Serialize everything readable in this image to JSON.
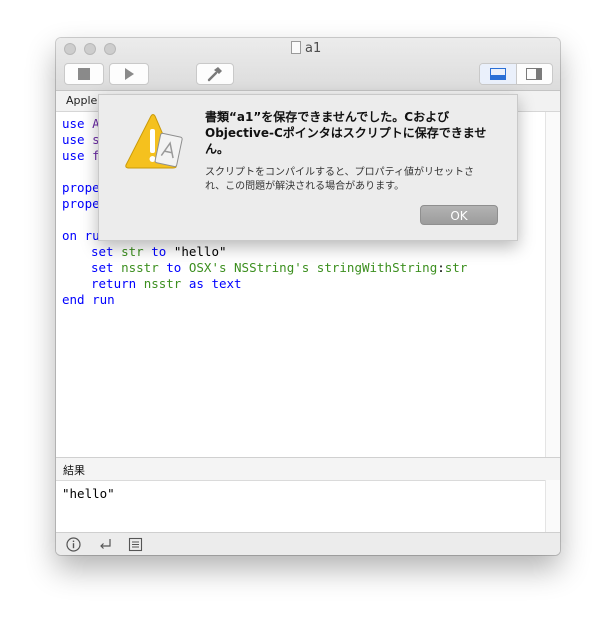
{
  "window": {
    "title": "a1"
  },
  "toolbar": {
    "stop": "stop-icon",
    "run": "play-icon",
    "compile": "hammer-icon",
    "view_bottom": "split-bottom-icon",
    "view_right": "split-right-icon"
  },
  "tabbar": {
    "label": "AppleS"
  },
  "editor": {
    "lines": [
      {
        "kw": "use",
        "rest": " A"
      },
      {
        "kw": "use",
        "rest": " s"
      },
      {
        "kw": "use",
        "rest": " f"
      },
      {
        "kw": "prope",
        "rest": ""
      },
      {
        "kw": "prope",
        "rest": ""
      },
      {
        "kw": "on",
        "rest": " ru"
      },
      {
        "kw": "set",
        "var": "str",
        "kw2": "to",
        "str": "\"hello\""
      },
      {
        "kw": "set",
        "var": "nsstr",
        "kw2": "to",
        "rest": "OSX's NSString's stringWithString",
        "colon": ":",
        "arg": "str"
      },
      {
        "kw": "return",
        "var": "nsstr",
        "kw2": "as",
        "rest": "text"
      },
      {
        "kw": "end",
        "rest": "run"
      }
    ]
  },
  "result": {
    "label": "結果",
    "value": "\"hello\""
  },
  "bottombar": {
    "info": "info-icon",
    "return": "return-icon",
    "list": "list-icon"
  },
  "dialog": {
    "title": "書類“a1”を保存できませんでした。CおよびObjective-Cポインタはスクリプトに保存できません。",
    "message": "スクリプトをコンパイルすると、プロパティ値がリセットされ、この問題が解決される場合があります。",
    "ok": "OK",
    "icon": "warning-icon"
  }
}
